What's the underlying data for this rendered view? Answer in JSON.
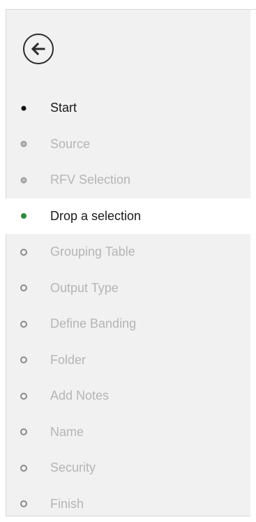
{
  "colors": {
    "panel_bg": "#f1f1f1",
    "active_bg": "#ffffff",
    "active_dot": "#2e8b3a",
    "text_done": "#1a1a1a",
    "text_pending": "#b5b5b5"
  },
  "back_button": {
    "icon": "arrow-left-icon"
  },
  "steps": [
    {
      "label": "Start",
      "state": "done"
    },
    {
      "label": "Source",
      "state": "visited"
    },
    {
      "label": "RFV Selection",
      "state": "visited"
    },
    {
      "label": "Drop a selection",
      "state": "active"
    },
    {
      "label": "Grouping Table",
      "state": "pending"
    },
    {
      "label": "Output Type",
      "state": "pending"
    },
    {
      "label": "Define Banding",
      "state": "pending"
    },
    {
      "label": "Folder",
      "state": "pending"
    },
    {
      "label": "Add Notes",
      "state": "pending"
    },
    {
      "label": "Name",
      "state": "pending"
    },
    {
      "label": "Security",
      "state": "pending"
    },
    {
      "label": "Finish",
      "state": "pending"
    }
  ]
}
